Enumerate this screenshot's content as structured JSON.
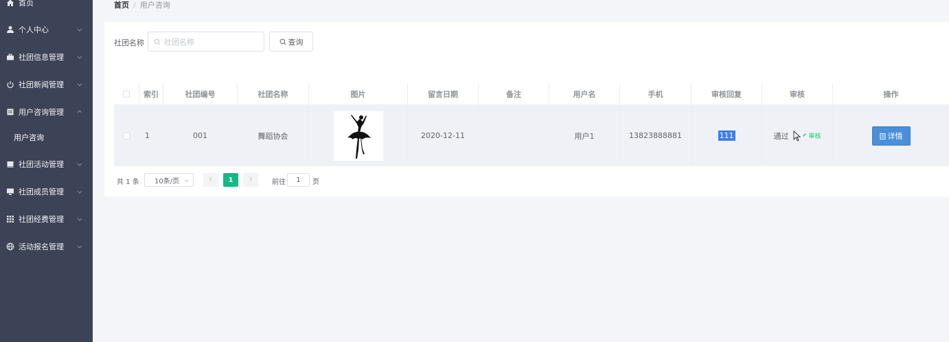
{
  "sidebar": {
    "items": [
      {
        "label": "首页",
        "icon": "home-icon"
      },
      {
        "label": "个人中心",
        "icon": "user-icon"
      },
      {
        "label": "社团信息管理",
        "icon": "briefcase-icon"
      },
      {
        "label": "社团新闻管理",
        "icon": "power-icon"
      },
      {
        "label": "用户咨询管理",
        "icon": "document-icon"
      },
      {
        "label": "社团活动管理",
        "icon": "folder-icon"
      },
      {
        "label": "社团成员管理",
        "icon": "monitor-icon"
      },
      {
        "label": "社团经费管理",
        "icon": "grid-icon"
      },
      {
        "label": "活动报名管理",
        "icon": "globe-icon"
      }
    ],
    "sub_item": "用户咨询"
  },
  "breadcrumb": {
    "home": "首页",
    "separator": "/",
    "current": "用户咨询"
  },
  "search": {
    "label": "社团名称",
    "placeholder": "社团名称",
    "button": "查询"
  },
  "table": {
    "headers": [
      "索引",
      "社团编号",
      "社团名称",
      "图片",
      "留言日期",
      "备注",
      "用户名",
      "手机",
      "审核回复",
      "审核",
      "操作"
    ],
    "rows": [
      {
        "index": "1",
        "club_id": "001",
        "club_name": "舞蹈协会",
        "image": "ballet-dancer-silhouette",
        "date": "2020-12-11",
        "note": "",
        "username": "用户1",
        "phone": "13823888881",
        "reply": "111",
        "status": "通过",
        "audit_link": "审核",
        "action": "详情"
      }
    ]
  },
  "pagination": {
    "total": "共 1 条",
    "page_size": "10条/页",
    "current_page": "1",
    "goto_label": "前往",
    "goto_value": "1",
    "page_suffix": "页"
  },
  "colors": {
    "sidebar_bg": "#3d4356",
    "accent_green": "#13b886",
    "detail_button": "#4a8fd9",
    "highlight": "#3f7ee6"
  }
}
